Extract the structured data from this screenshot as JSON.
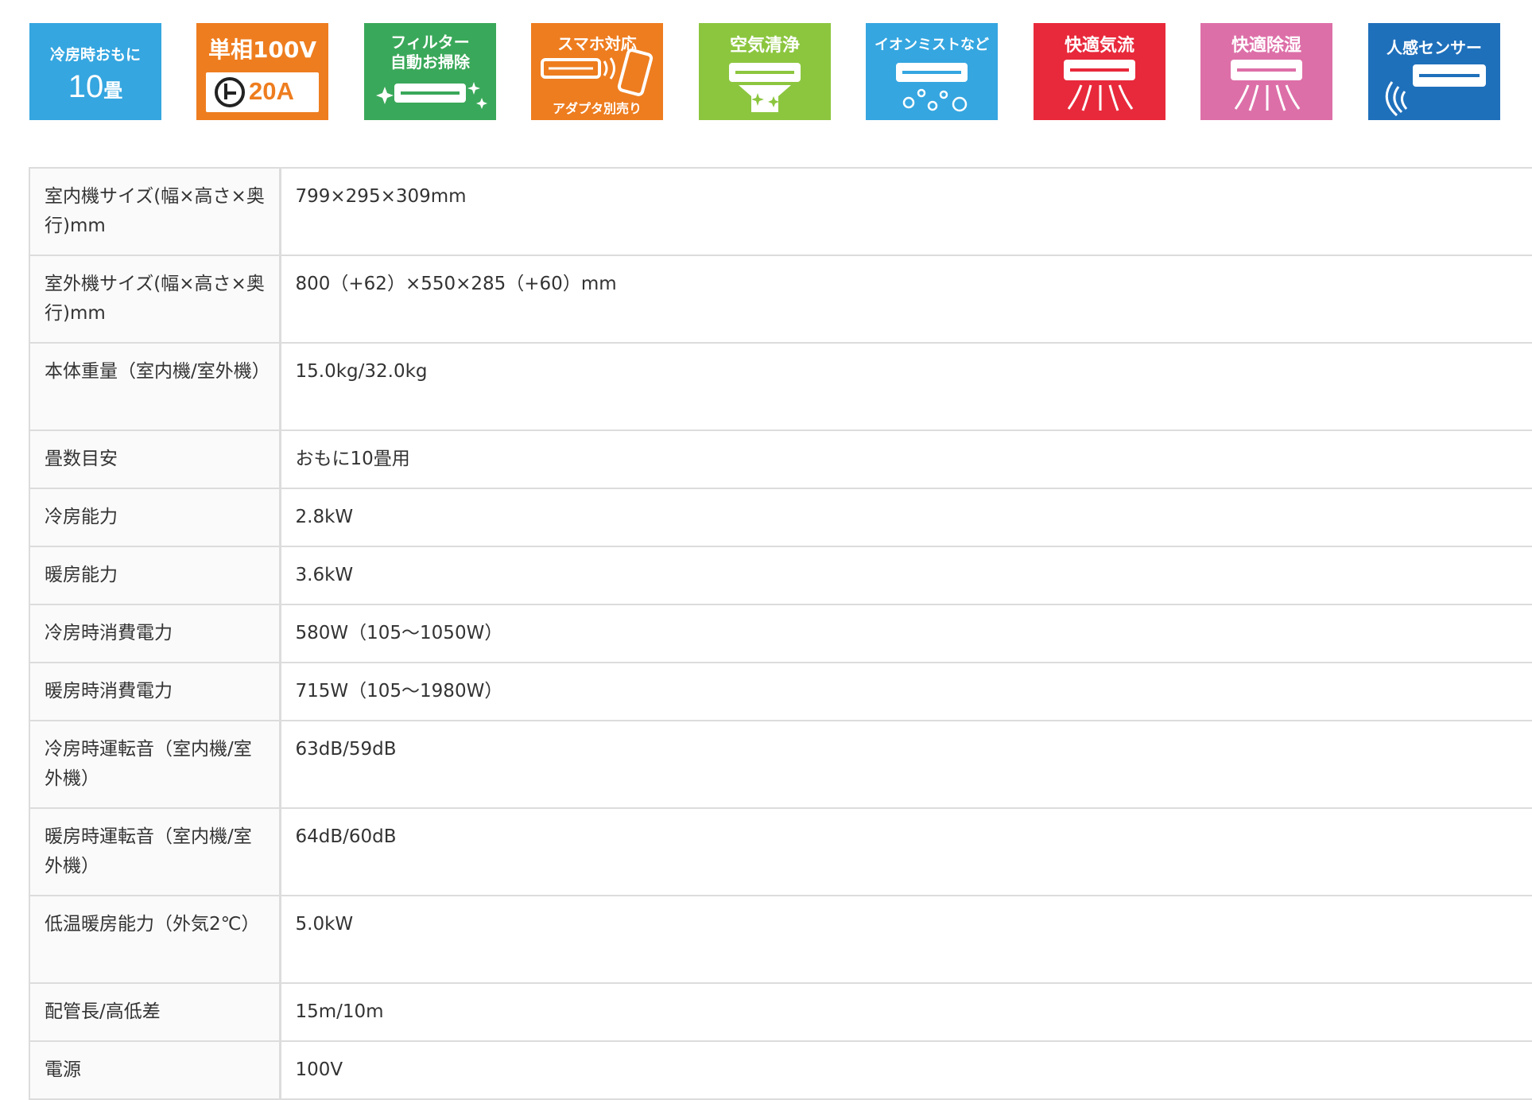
{
  "features": [
    {
      "name": "cooling-tatami",
      "line1": "冷房時おもに",
      "line2": "10",
      "unit": "畳",
      "color": "#35a6e0"
    },
    {
      "name": "single-phase",
      "line1": "単相100V",
      "amp": "20A",
      "color": "#ee7d1f"
    },
    {
      "name": "filter-auto-clean",
      "line1": "フィルター",
      "line2": "自動お掃除",
      "color": "#3aa85a"
    },
    {
      "name": "smartphone",
      "line1": "スマホ対応",
      "line2": "アダプタ別売り",
      "color": "#ee7d1f"
    },
    {
      "name": "air-purify",
      "line1": "空気清浄",
      "color": "#8cc63f"
    },
    {
      "name": "ion-mist",
      "line1": "イオンミストなど",
      "color": "#35a6e0"
    },
    {
      "name": "comfort-airflow",
      "line1": "快適気流",
      "color": "#e8293b"
    },
    {
      "name": "comfort-dehumid",
      "line1": "快適除湿",
      "color": "#dd6fa8"
    },
    {
      "name": "human-sensor",
      "line1": "人感センサー",
      "color": "#1f70bb"
    }
  ],
  "specs": [
    {
      "label": "室内機サイズ(幅×高さ×奥行)mm",
      "value": "799×295×309mm"
    },
    {
      "label": "室外機サイズ(幅×高さ×奥行)mm",
      "value": "800（+62）×550×285（+60）mm"
    },
    {
      "label": "本体重量（室内機/室外機）",
      "value": "15.0kg/32.0kg"
    },
    {
      "label": "畳数目安",
      "value": "おもに10畳用"
    },
    {
      "label": "冷房能力",
      "value": "2.8kW"
    },
    {
      "label": "暖房能力",
      "value": "3.6kW"
    },
    {
      "label": "冷房時消費電力",
      "value": "580W（105〜1050W）"
    },
    {
      "label": "暖房時消費電力",
      "value": "715W（105〜1980W）"
    },
    {
      "label": "冷房時運転音（室内機/室外機）",
      "value": "63dB/59dB"
    },
    {
      "label": "暖房時運転音（室内機/室外機）",
      "value": "64dB/60dB"
    },
    {
      "label": "低温暖房能力（外気2℃）",
      "value": "5.0kW"
    },
    {
      "label": "配管長/高低差",
      "value": "15m/10m"
    },
    {
      "label": "電源",
      "value": "100V"
    }
  ]
}
